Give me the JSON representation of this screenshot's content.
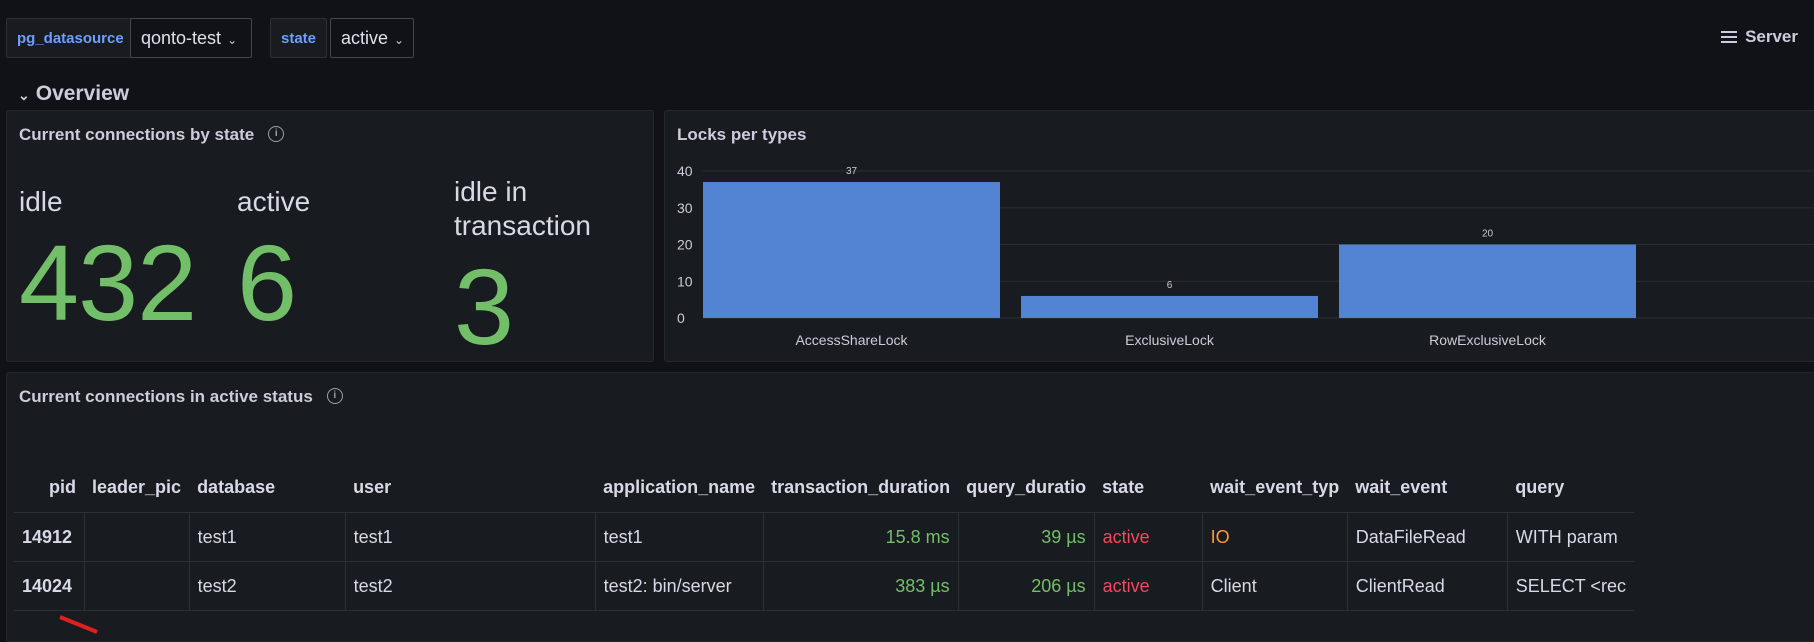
{
  "variables": [
    {
      "label": "pg_datasource",
      "value": "qonto-test"
    },
    {
      "label": "state",
      "value": "active"
    }
  ],
  "server_link": "Server",
  "row_title": "Overview",
  "connections_panel": {
    "title": "Current connections by state",
    "stats": [
      {
        "name": "idle",
        "value": "432"
      },
      {
        "name": "active",
        "value": "6"
      },
      {
        "name": "idle in transaction",
        "value": "3"
      }
    ]
  },
  "locks_panel": {
    "title": "Locks per types"
  },
  "chart_data": {
    "type": "bar",
    "title": "Locks per types",
    "categories": [
      "AccessShareLock",
      "ExclusiveLock",
      "RowExclusiveLock"
    ],
    "values": [
      37,
      6,
      20
    ],
    "ylim": [
      0,
      40
    ],
    "yticks": [
      0,
      10,
      20,
      30,
      40
    ],
    "grid": true,
    "bar_color": "#5383d3"
  },
  "active_panel": {
    "title": "Current connections in active status",
    "columns": [
      "pid",
      "leader_pic",
      "database",
      "user",
      "application_name",
      "transaction_duration",
      "query_duratio",
      "state",
      "wait_event_typ",
      "wait_event",
      "query"
    ],
    "rows": [
      {
        "pid": "14912",
        "leader_pid": "",
        "database": "test1",
        "user": "test1",
        "application_name": "test1",
        "transaction_duration": "15.8 ms",
        "query_duration": "39 µs",
        "state": "active",
        "wait_event_type": "IO",
        "wait_event": "DataFileRead",
        "query": "WITH param"
      },
      {
        "pid": "14024",
        "leader_pid": "",
        "database": "test2",
        "user": "test2",
        "application_name": "test2: bin/server",
        "transaction_duration": "383 µs",
        "query_duration": "206 µs",
        "state": "active",
        "wait_event_type": "Client",
        "wait_event": "ClientRead",
        "query": "SELECT <rec"
      }
    ]
  },
  "colors": {
    "background": "#111217",
    "panel": "#181b1f",
    "stat_green": "#73bf69",
    "link_blue": "#6e9fff",
    "state_red": "#f2495c",
    "io_orange": "#ff9830"
  }
}
